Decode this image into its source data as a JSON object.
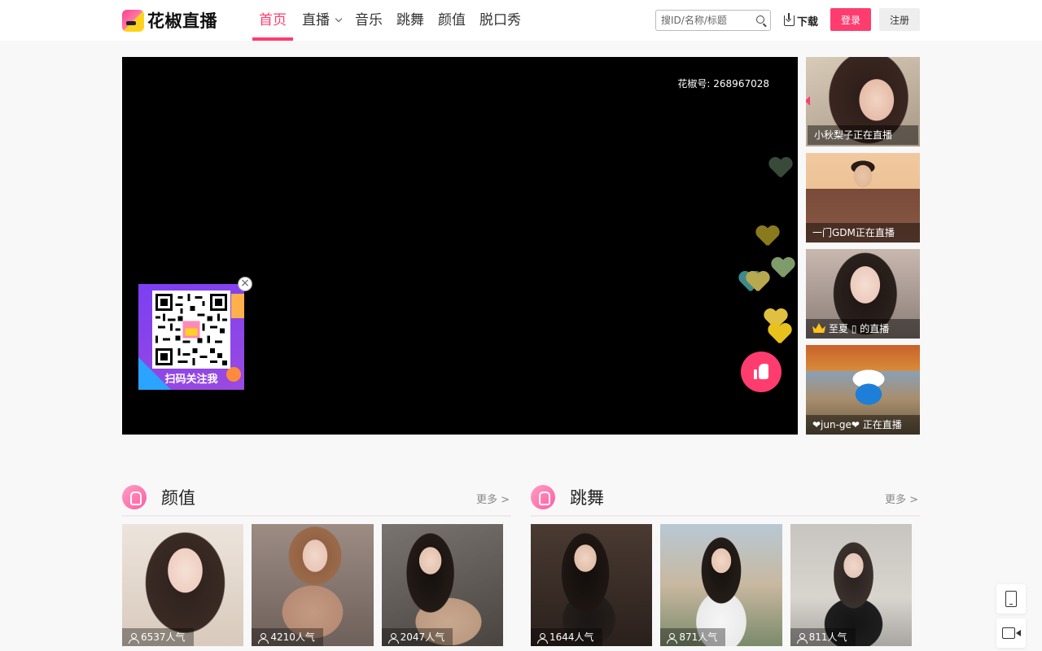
{
  "header": {
    "logo_text": "花椒直播",
    "nav": [
      {
        "label": "首页",
        "active": true
      },
      {
        "label": "直播",
        "has_dropdown": true
      },
      {
        "label": "音乐"
      },
      {
        "label": "跳舞"
      },
      {
        "label": "颜值"
      },
      {
        "label": "脱口秀"
      }
    ],
    "search_placeholder": "搜ID/名称/标题",
    "download_label": "下载",
    "login_label": "登录",
    "register_label": "注册",
    "accent_color": "#ff3c6e"
  },
  "player": {
    "room_id": "花椒号: 268967028",
    "qr_label": "扫码关注我",
    "close_glyph": "×"
  },
  "side_list": [
    {
      "caption": "小秋梨子正在直播",
      "active": true
    },
    {
      "caption": "一门GDM正在直播"
    },
    {
      "caption": "至夏 ▯ 的直播",
      "crown": true
    },
    {
      "caption": "❤jun-ge❤ 正在直播"
    }
  ],
  "sections": [
    {
      "title": "颜值",
      "more": "更多 >",
      "cards": [
        {
          "popularity": "6537人气"
        },
        {
          "popularity": "4210人气"
        },
        {
          "popularity": "2047人气"
        }
      ]
    },
    {
      "title": "跳舞",
      "more": "更多 >",
      "cards": [
        {
          "popularity": "1644人气"
        },
        {
          "popularity": "871人气"
        },
        {
          "popularity": "811人气"
        }
      ]
    }
  ]
}
